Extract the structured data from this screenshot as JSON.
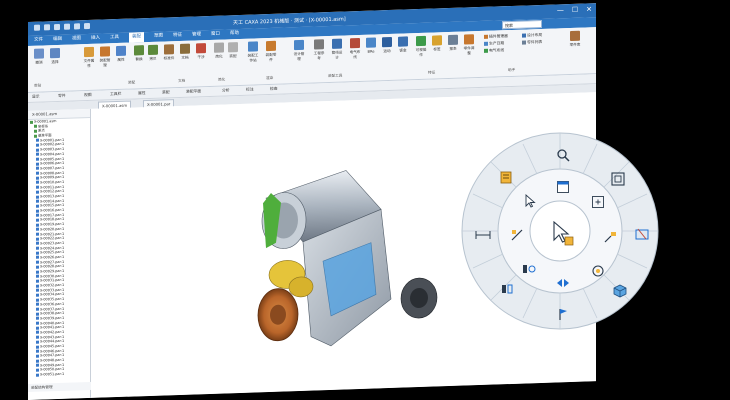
{
  "window": {
    "title": "天工 CAXA 2023 机械版 · 测试 · [X-00001.asm]",
    "search_placeholder": "搜索",
    "minimize": "—",
    "maximize": "☐",
    "close": "✕"
  },
  "menu": [
    "文件",
    "编辑",
    "视图",
    "插入",
    "工具",
    "装配",
    "草图",
    "特征",
    "管理",
    "窗口",
    "帮助"
  ],
  "ribbon": {
    "buttons": [
      {
        "label": "撤消",
        "icon": "undo-icon",
        "color": "#6a8fc8"
      },
      {
        "label": "选择",
        "icon": "select-icon",
        "color": "#5e86c2"
      },
      {
        "label": "文件属性",
        "icon": "file-properties-icon",
        "color": "#d89a3a"
      },
      {
        "label": "装配管理",
        "icon": "assembly-manage-icon",
        "color": "#c7772e"
      },
      {
        "label": "属性",
        "icon": "properties-icon",
        "color": "#4f83c9"
      },
      {
        "label": "替换",
        "icon": "replace-icon",
        "color": "#5c8a3b"
      },
      {
        "label": "拷贝",
        "icon": "copy-icon",
        "color": "#5c8a3b"
      },
      {
        "label": "标准件",
        "icon": "standard-part-icon",
        "color": "#9d6e3b"
      },
      {
        "label": "文档",
        "icon": "document-icon",
        "color": "#8a6d3b"
      },
      {
        "label": "干涉",
        "icon": "interference-icon",
        "color": "#c24a3a"
      },
      {
        "label": "简化",
        "icon": "simplify-icon",
        "color": "#a8a8a8"
      },
      {
        "label": "装配",
        "icon": "assembly-icon",
        "color": "#b0b0b0"
      },
      {
        "label": "装配工作站",
        "icon": "workstation-icon",
        "color": "#4a86c8"
      },
      {
        "label": "装配零件",
        "icon": "assembly-part-icon",
        "color": "#c77a2e"
      },
      {
        "label": "设计管理",
        "icon": "design-manage-icon",
        "color": "#4a86c8"
      },
      {
        "label": "工程参考",
        "icon": "engineering-ref-icon",
        "color": "#7a7a7a"
      },
      {
        "label": "管线设计",
        "icon": "pipe-design-icon",
        "color": "#3a6fb0"
      },
      {
        "label": "电气布线",
        "icon": "electric-wiring-icon",
        "color": "#b54a3a"
      },
      {
        "label": "BRe",
        "icon": "bre-icon",
        "color": "#4a86c8"
      },
      {
        "label": "运动",
        "icon": "motion-icon",
        "color": "#2e5f9e"
      },
      {
        "label": "钣金",
        "icon": "sheetmetal-icon",
        "color": "#3a6fb0"
      },
      {
        "label": "可视操作",
        "icon": "visual-op-icon",
        "color": "#3c9a4a"
      },
      {
        "label": "标签",
        "icon": "tag-icon",
        "color": "#d8a22e"
      },
      {
        "label": "报表",
        "icon": "report-icon",
        "color": "#6b7f96"
      },
      {
        "label": "零件调整",
        "icon": "part-adjust-icon",
        "color": "#c7772e"
      }
    ],
    "group_labels": [
      "剪贴",
      "装配",
      "文档",
      "简化",
      "渲染",
      "装配工具",
      "特征",
      "助手"
    ],
    "right_items": [
      "插件管理器",
      "生产日期",
      "电气布线",
      "设计布局",
      "零件列表",
      "标准模板"
    ],
    "far_right": "零件库"
  },
  "toolbar2": [
    "显示",
    "零件",
    "视图",
    "工具栏",
    "属性",
    "装配",
    "装配平面",
    "分析",
    "标注",
    "检查"
  ],
  "tabs": [
    "X-00001.asm",
    "X-00001.par"
  ],
  "tree": {
    "header": "X-00001.asm",
    "items": [
      "X-00001.asm",
      "坐标系",
      "原点",
      "基准平面",
      "X-00001.par:1",
      "X-00002.par:1",
      "X-00003.par:1",
      "X-00004.par:1",
      "X-00005.par:1",
      "X-00006.par:1",
      "X-00007.par:1",
      "X-00008.par:1",
      "X-00009.par:1",
      "X-00010.par:1",
      "X-00011.par:1",
      "X-00012.par:1",
      "X-00013.par:1",
      "X-00014.par:1",
      "X-00015.par:1",
      "X-00016.par:1",
      "X-00017.par:1",
      "X-00018.par:1",
      "X-00019.par:1",
      "X-00020.par:1",
      "X-00021.par:1",
      "X-00022.par:1",
      "X-00023.par:1",
      "X-00024.par:1",
      "X-00025.par:1",
      "X-00026.par:1",
      "X-00027.par:1",
      "X-00028.par:1",
      "X-00029.par:1",
      "X-00030.par:1",
      "X-00031.par:1",
      "X-00032.par:1",
      "X-00033.par:1",
      "X-00034.par:1",
      "X-00035.par:1",
      "X-00036.par:1",
      "X-00037.par:1",
      "X-00038.par:1",
      "X-00039.par:1",
      "X-00040.par:1",
      "X-00041.par:1",
      "X-00042.par:1",
      "X-00043.par:1",
      "X-00044.par:1",
      "X-00045.par:1",
      "X-00046.par:1",
      "X-00047.par:1",
      "X-00048.par:1",
      "X-00049.par:1",
      "X-00050.par:1",
      "X-00051.par:1"
    ]
  },
  "status": "装配结构管理",
  "right_strip": "工程图",
  "radial_menu": {
    "outer_icons": [
      "zoom-icon",
      "fit-view-icon",
      "section-view-icon",
      "properties-panel-icon",
      "view-cube-icon",
      "flag-icon",
      "isolate-icon",
      "measure-icon",
      "notes-icon"
    ],
    "inner_icons": [
      "window-view-icon",
      "fit-icon",
      "move-component-icon",
      "rotate-icon",
      "flip-icon",
      "align-icon",
      "mate-icon",
      "select-arrow-icon"
    ],
    "center_icon": "cursor-select-icon",
    "accent": "#1f6fd1"
  }
}
